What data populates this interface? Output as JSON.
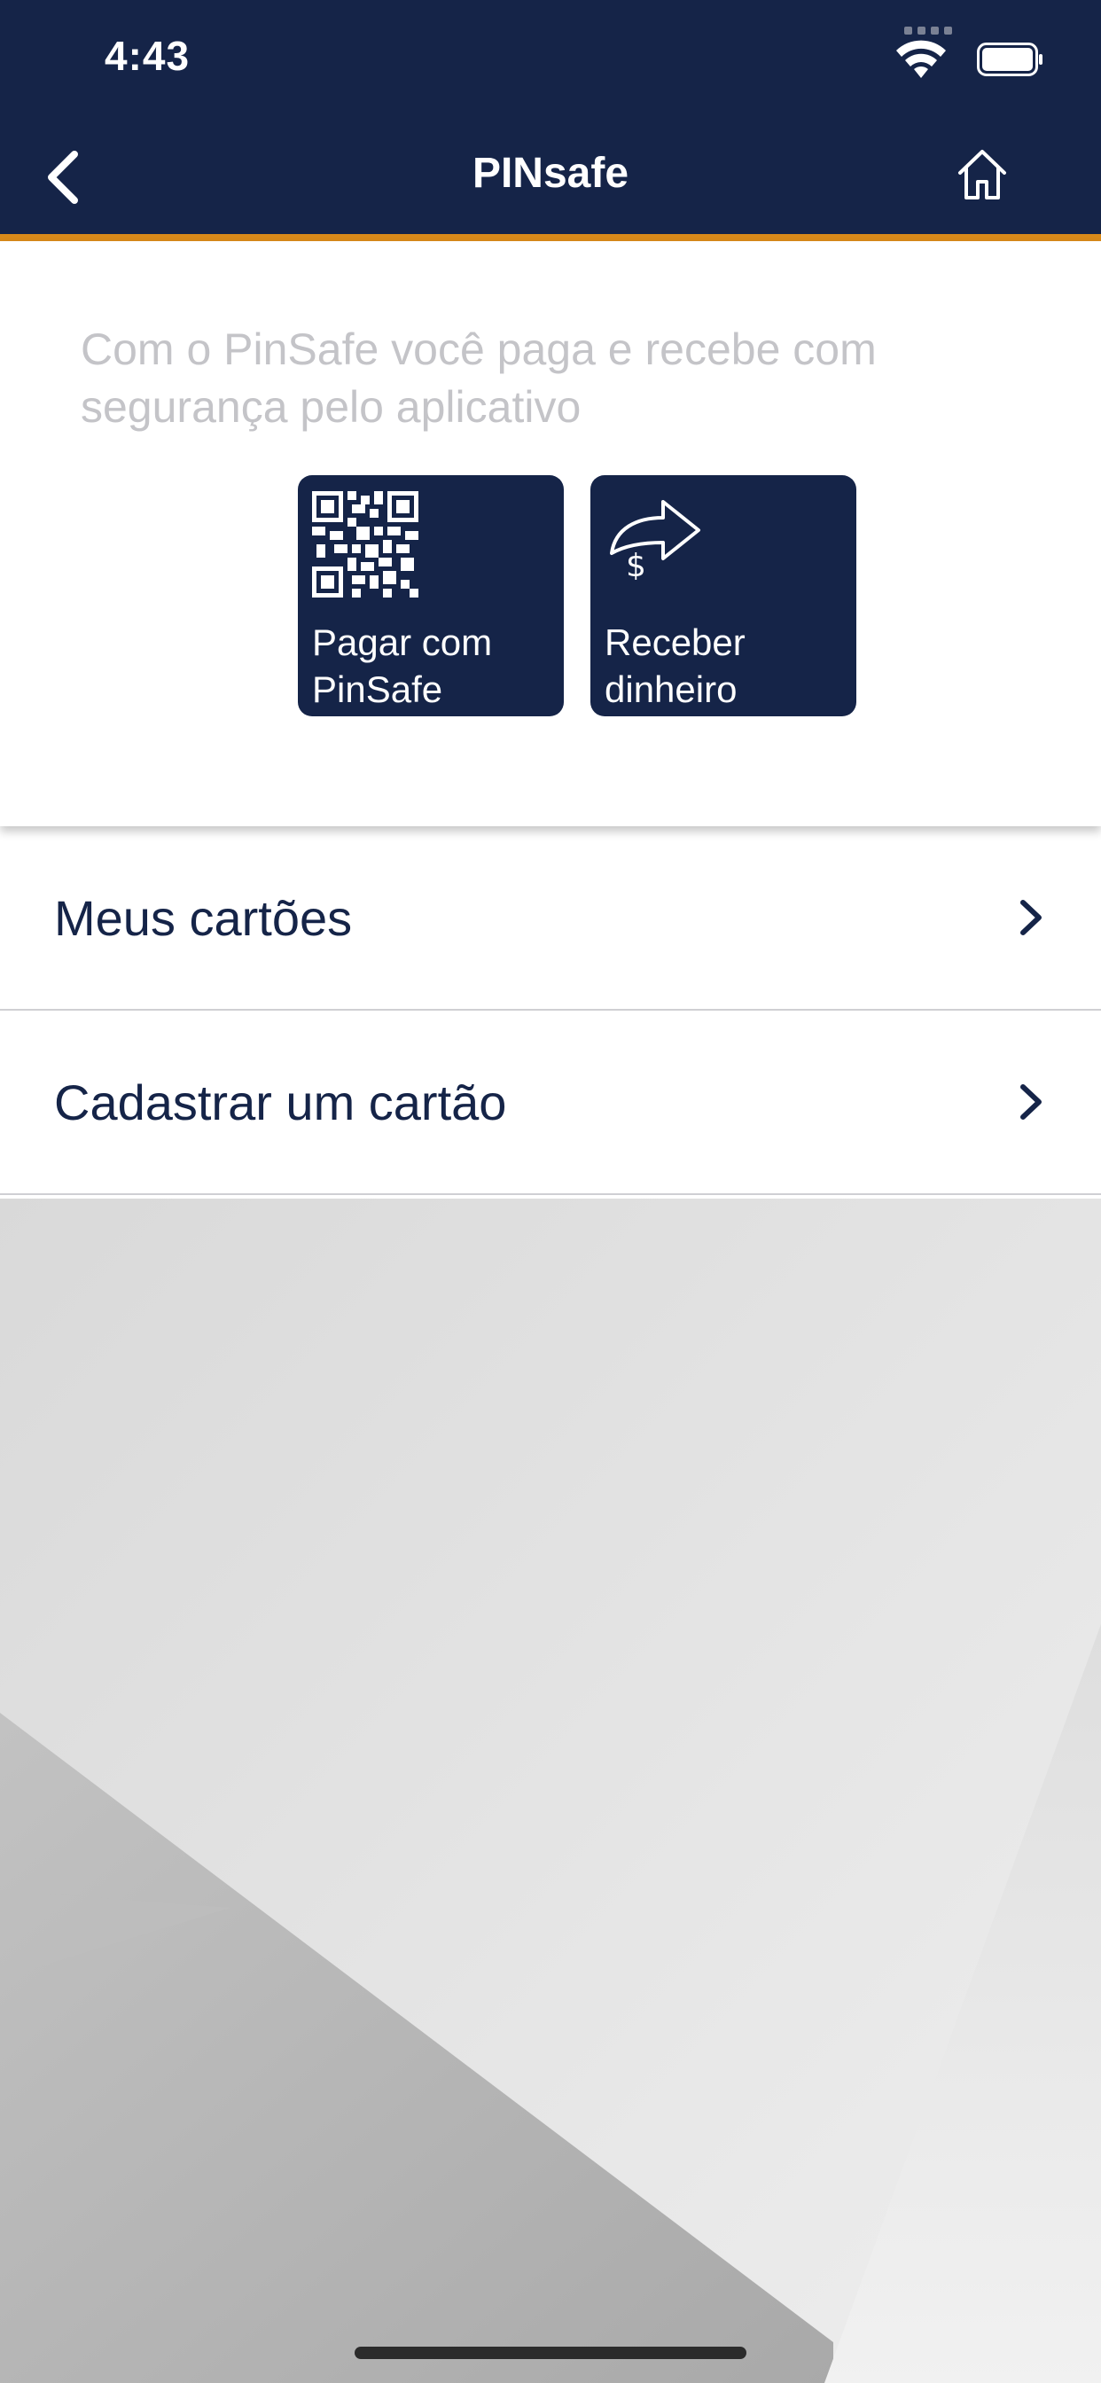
{
  "status_bar": {
    "time": "4:43"
  },
  "nav": {
    "title": "PINsafe"
  },
  "intro": {
    "description": "Com o PinSafe você paga e recebe com segurança pelo aplicativo"
  },
  "actions": [
    {
      "label": "Pagar com PinSafe",
      "icon": "qr-code-icon"
    },
    {
      "label": "Receber dinheiro",
      "icon": "share-money-arrow-icon"
    }
  ],
  "menu": [
    {
      "label": "Meus cartões"
    },
    {
      "label": "Cadastrar um cartão"
    }
  ],
  "colors": {
    "header_bg": "#152448",
    "accent": "#d98a1a",
    "button_bg": "#152448",
    "list_text": "#152448",
    "intro_text": "#c4c4c8"
  }
}
